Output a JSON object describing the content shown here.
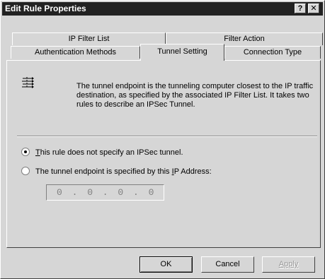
{
  "window": {
    "title": "Edit Rule Properties",
    "help_label": "?",
    "close_label": "✕"
  },
  "tabs": {
    "row1": [
      "IP Filter List",
      "Filter Action"
    ],
    "row2": [
      "Authentication Methods",
      "Tunnel Setting",
      "Connection Type"
    ],
    "active": "Tunnel Setting"
  },
  "panel": {
    "info_icon": "tunnel-lines-icon",
    "info_text": "The tunnel endpoint is the tunneling computer closest to the IP traffic destination, as specified by the associated IP Filter List. It takes two rules to describe an IPSec Tunnel.",
    "option1": {
      "mnemonic": "T",
      "rest": "his rule does not specify an IPSec tunnel.",
      "checked": true
    },
    "option2": {
      "before": "The tunnel endpoint is specified by this ",
      "mnemonic": "I",
      "after": "P Address:",
      "checked": false
    },
    "ip_address": "0 . 0 . 0 . 0"
  },
  "buttons": {
    "ok": "OK",
    "cancel": "Cancel",
    "apply": "Apply"
  }
}
